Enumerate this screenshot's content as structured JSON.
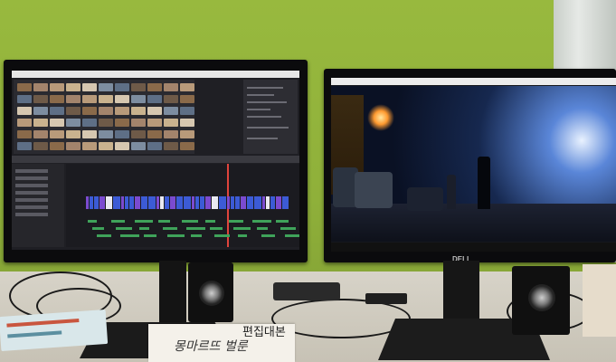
{
  "scene": {
    "left_monitor": {
      "content": "video-editing-timeline"
    },
    "right_monitor": {
      "brand": "DELL",
      "content": "night-street-video-frame"
    },
    "book": {
      "title": "편집대본",
      "subtitle": "몽마르뜨 벌룬"
    }
  },
  "colors": {
    "wall": "#98b93e",
    "clip_blue": "#3c5bd6",
    "clip_purple": "#7b4bd0",
    "playhead": "#e0443c",
    "audio": "#3fa35a",
    "lamp": "#ff9a30"
  }
}
